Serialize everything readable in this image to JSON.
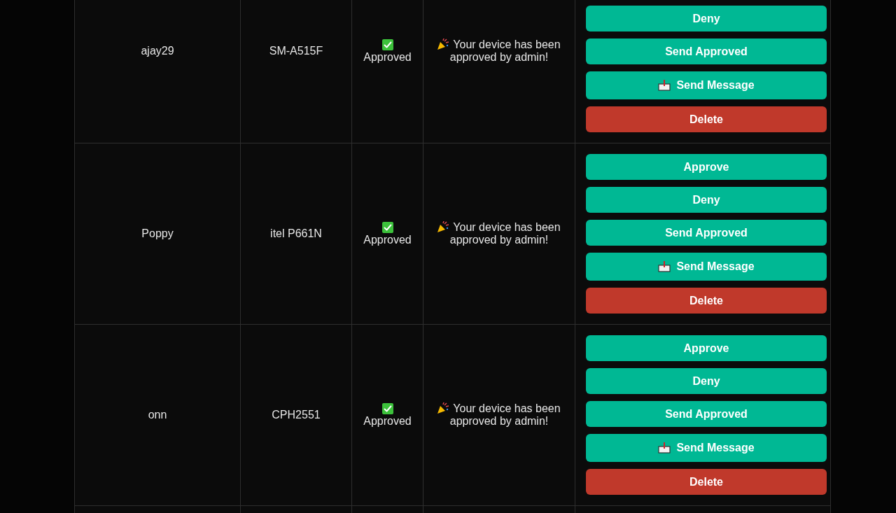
{
  "rows": [
    {
      "name": "ajay29",
      "device": "SM-A515F",
      "status": "Approved",
      "message": "Your device has been approved by admin!",
      "actions": [
        {
          "label": "Deny",
          "kind": "deny"
        },
        {
          "label": "Send Approved",
          "kind": "send-approved"
        },
        {
          "label": "Send Message",
          "kind": "send-message"
        },
        {
          "label": "Delete",
          "kind": "delete"
        }
      ]
    },
    {
      "name": "Poppy",
      "device": "itel P661N",
      "status": "Approved",
      "message": "Your device has been approved by admin!",
      "actions": [
        {
          "label": "Approve",
          "kind": "approve"
        },
        {
          "label": "Deny",
          "kind": "deny"
        },
        {
          "label": "Send Approved",
          "kind": "send-approved"
        },
        {
          "label": "Send Message",
          "kind": "send-message"
        },
        {
          "label": "Delete",
          "kind": "delete"
        }
      ]
    },
    {
      "name": "onn",
      "device": "CPH2551",
      "status": "Approved",
      "message": "Your device has been approved by admin!",
      "actions": [
        {
          "label": "Approve",
          "kind": "approve"
        },
        {
          "label": "Deny",
          "kind": "deny"
        },
        {
          "label": "Send Approved",
          "kind": "send-approved"
        },
        {
          "label": "Send Message",
          "kind": "send-message"
        },
        {
          "label": "Delete",
          "kind": "delete"
        }
      ]
    }
  ]
}
